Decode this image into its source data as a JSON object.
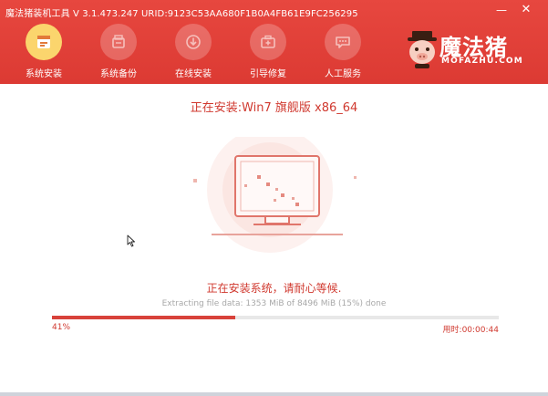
{
  "window": {
    "title": "魔法猪装机工具 V 3.1.473.247 URID:9123C53AA680F1B0A4FB61E9FC256295",
    "minimize_glyph": "—",
    "close_glyph": "✕"
  },
  "nav": {
    "items": [
      {
        "label": "系统安装",
        "icon": "system-install-icon",
        "active": true
      },
      {
        "label": "系统备份",
        "icon": "system-backup-icon",
        "active": false
      },
      {
        "label": "在线安装",
        "icon": "online-install-icon",
        "active": false
      },
      {
        "label": "引导修复",
        "icon": "boot-repair-icon",
        "active": false
      },
      {
        "label": "人工服务",
        "icon": "chat-service-icon",
        "active": false
      }
    ]
  },
  "logo": {
    "name": "魔法猪",
    "domain": "MOFAZHU.COM"
  },
  "install": {
    "title": "正在安装:Win7 旗舰版 x86_64",
    "status": "正在安装系统，请耐心等候.",
    "detail": "Extracting file data: 1353 MiB of 8496 MiB (15%) done",
    "progress_label": "41%",
    "progress_fraction": 0.41,
    "elapsed": "用时:00:00:44"
  },
  "colors": {
    "header_red": "#dc3a33",
    "accent_red": "#d0392f",
    "active_icon_yellow": "#fbd56d"
  }
}
